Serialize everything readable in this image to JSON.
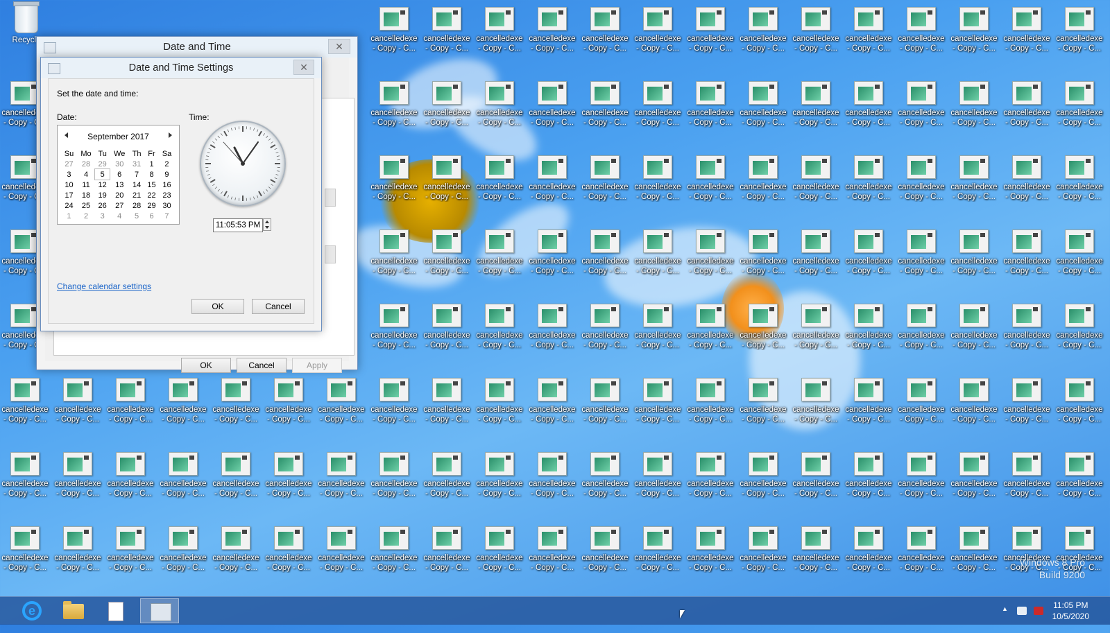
{
  "desktop": {
    "recycle_label": "Recycle",
    "icon_label_line1": "cancelledexe",
    "icon_label_line2": "- Copy - C...",
    "icon_label_line2_short": "- Copy -",
    "watermark_line1": "Windows 8 Pro",
    "watermark_line2": "Build 9200"
  },
  "outer_dialog": {
    "title": "Date and Time",
    "ok_label": "OK",
    "cancel_label": "Cancel",
    "apply_label": "Apply",
    "close_glyph": "✕"
  },
  "inner_dialog": {
    "title": "Date and Time Settings",
    "close_glyph": "✕",
    "instruction": "Set the date and time:",
    "date_label": "Date:",
    "time_label": "Time:",
    "calendar": {
      "month_title": "September 2017",
      "weekdays": [
        "Su",
        "Mo",
        "Tu",
        "We",
        "Th",
        "Fr",
        "Sa"
      ],
      "weeks": [
        [
          "27",
          "28",
          "29",
          "30",
          "31",
          "1",
          "2"
        ],
        [
          "3",
          "4",
          "5",
          "6",
          "7",
          "8",
          "9"
        ],
        [
          "10",
          "11",
          "12",
          "13",
          "14",
          "15",
          "16"
        ],
        [
          "17",
          "18",
          "19",
          "20",
          "21",
          "22",
          "23"
        ],
        [
          "24",
          "25",
          "26",
          "27",
          "28",
          "29",
          "30"
        ],
        [
          "1",
          "2",
          "3",
          "4",
          "5",
          "6",
          "7"
        ]
      ],
      "selected_day": "5"
    },
    "clock": {
      "hour": 11,
      "minute": 5,
      "second": 53
    },
    "time_value": "11:05:53 PM",
    "change_calendar_link": "Change calendar settings",
    "ok_label": "OK",
    "cancel_label": "Cancel"
  },
  "taskbar": {
    "apps": [
      "internet-explorer",
      "file-explorer",
      "document",
      "date-time-settings"
    ],
    "clock_time": "11:05 PM",
    "clock_date": "10/5/2020",
    "tray_overflow_glyph": "▲"
  },
  "colors": {
    "desktop_bg": "#3d8fe6",
    "taskbar_bg": "#285aa0",
    "link": "#1a64c8"
  }
}
